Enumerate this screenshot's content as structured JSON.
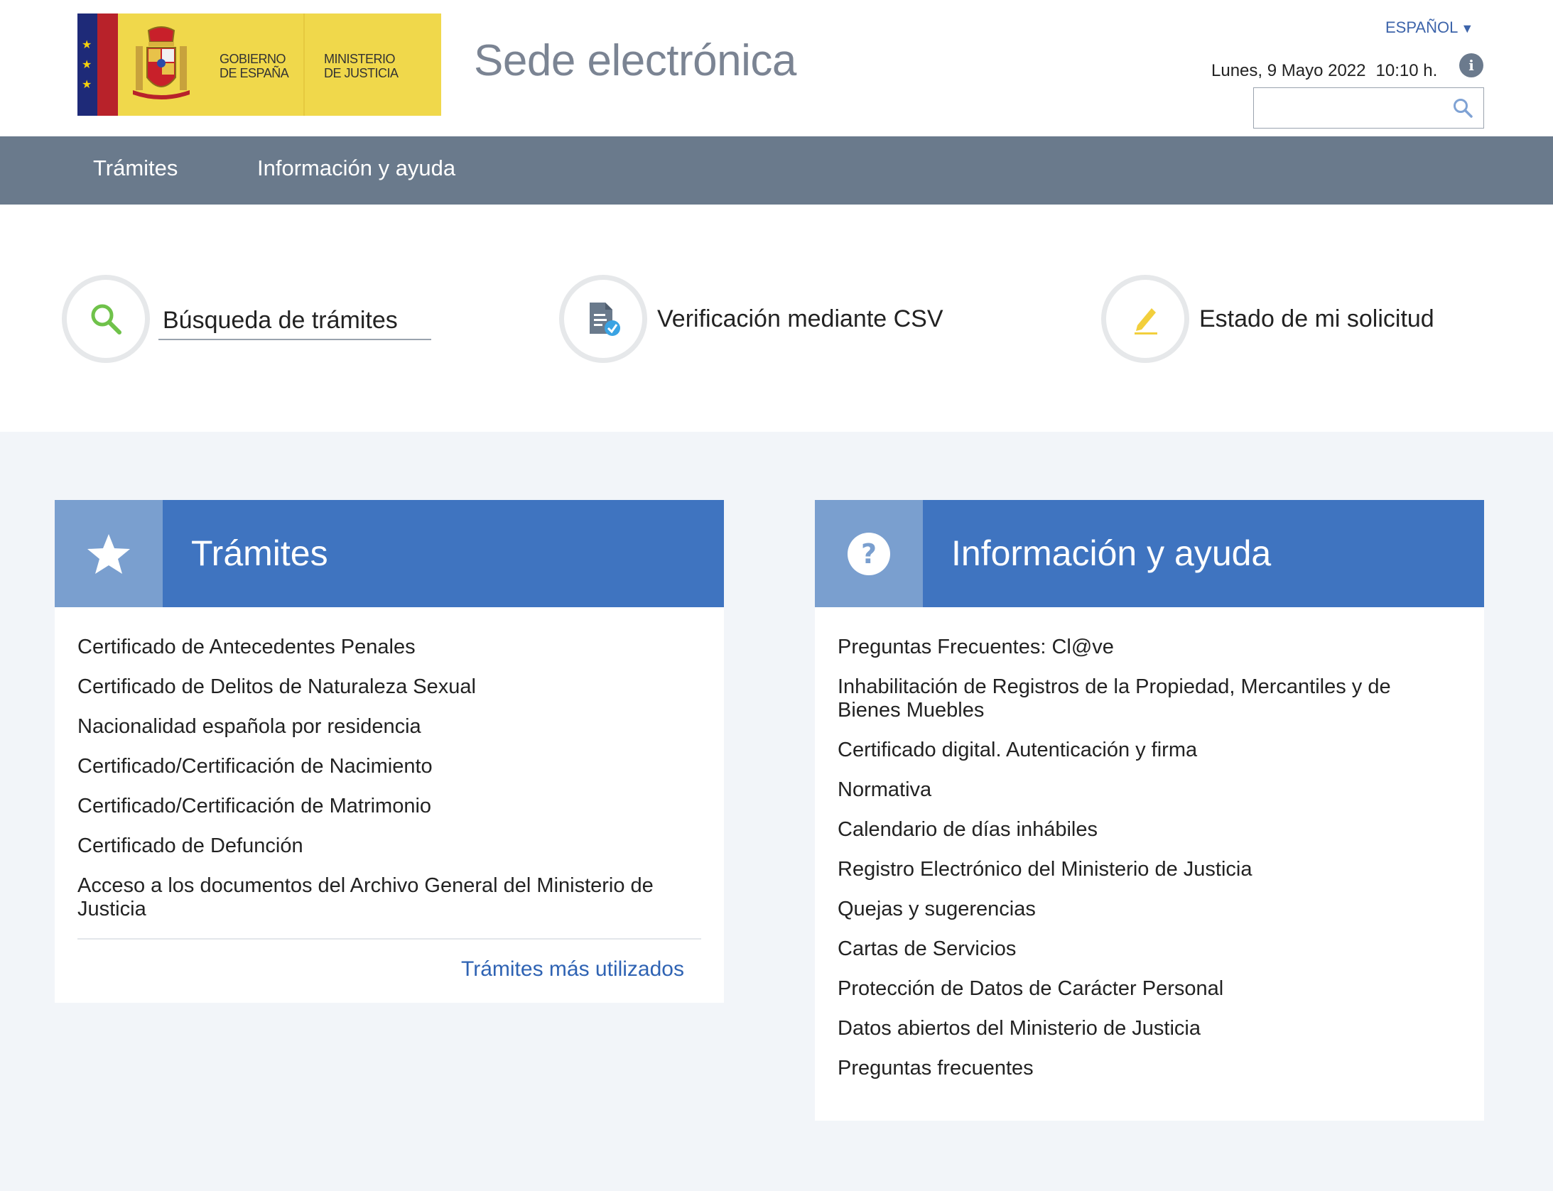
{
  "header": {
    "logo_left_line1": "GOBIERNO",
    "logo_left_line2": "DE ESPAÑA",
    "logo_right_line1": "MINISTERIO",
    "logo_right_line2": "DE JUSTICIA",
    "site_title": "Sede electrónica",
    "language": "ESPAÑOL",
    "date": "Lunes, 9 Mayo 2022",
    "time": "10:10 h.",
    "search_value": ""
  },
  "nav": {
    "items": [
      {
        "label": "Trámites"
      },
      {
        "label": "Información y ayuda"
      }
    ]
  },
  "quick_access": [
    {
      "label": "Búsqueda de trámites",
      "icon": "search-icon"
    },
    {
      "label": "Verificación mediante CSV",
      "icon": "document-check-icon"
    },
    {
      "label": "Estado de mi solicitud",
      "icon": "pencil-icon"
    }
  ],
  "tramites_panel": {
    "title": "Trámites",
    "icon": "star-icon",
    "items": [
      "Certificado de Antecedentes Penales",
      "Certificado de Delitos de Naturaleza Sexual",
      "Nacionalidad española por residencia",
      "Certificado/Certificación de Nacimiento",
      "Certificado/Certificación de Matrimonio",
      "Certificado de Defunción",
      "Acceso a los documentos del Archivo General del Ministerio de Justicia"
    ],
    "more_link": "Trámites más utilizados"
  },
  "info_panel": {
    "title": "Información y ayuda",
    "icon": "question-icon",
    "items": [
      "Preguntas Frecuentes: Cl@ve",
      "Inhabilitación de Registros de la Propiedad, Mercantiles y de Bienes Muebles",
      "Certificado digital. Autenticación y firma",
      "Normativa",
      "Calendario de días inhábiles",
      "Registro Electrónico del Ministerio de Justicia",
      "Quejas y sugerencias",
      "Cartas de Servicios",
      "Protección de Datos de Carácter Personal",
      "Datos abiertos del Ministerio de Justicia",
      "Preguntas frecuentes"
    ]
  },
  "colors": {
    "nav_bg": "#6a7a8c",
    "panel_header": "#3f74c0",
    "panel_icon_box": "#7a9fcf",
    "link": "#2f63b3",
    "logo_yellow": "#f0d84b"
  }
}
